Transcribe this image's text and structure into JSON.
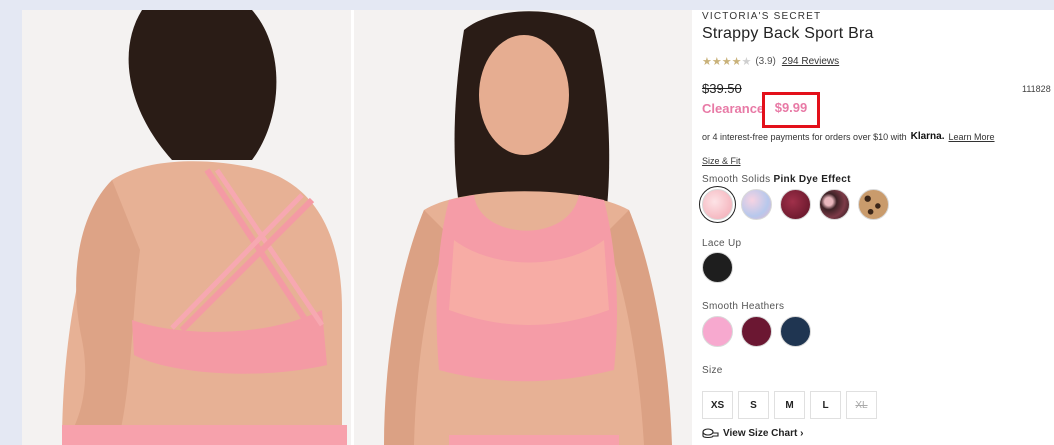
{
  "product": {
    "brand": "VICTORIA'S SECRET",
    "title": "Strappy Back Sport Bra",
    "rating_value": "(3.9)",
    "rating_stars": 3.9,
    "reviews_label": "294 Reviews",
    "original_price": "$39.50",
    "sku": "111828",
    "clearance_label": "Clearance",
    "sale_price": "$9.99",
    "installments_text": "or 4 interest-free payments for orders over $10 with",
    "klarna_label": "Klarna.",
    "learn_more": "Learn More",
    "size_fit": "Size & Fit"
  },
  "colors": {
    "smooth_solids_label": "Smooth Solids",
    "selected_color": "Pink Dye Effect",
    "smooth_solids": [
      {
        "name": "Pink Dye Effect",
        "color": "#f5c1c6"
      },
      {
        "name": "Blue Pink Dye",
        "color": "#c8d4ee"
      },
      {
        "name": "Wine Dye",
        "color": "#7a1d2e"
      },
      {
        "name": "Dark Floral",
        "color": "#4a2a30"
      },
      {
        "name": "Leopard",
        "color": "#b8865a"
      }
    ],
    "lace_up_label": "Lace Up",
    "lace_up": [
      {
        "name": "Black",
        "color": "#1e1e1e"
      }
    ],
    "smooth_heathers_label": "Smooth Heathers",
    "smooth_heathers": [
      {
        "name": "Pink Heather",
        "color": "#f7a9cf"
      },
      {
        "name": "Burgundy Heather",
        "color": "#6b1732"
      },
      {
        "name": "Navy Heather",
        "color": "#1f3551"
      }
    ]
  },
  "sizes": {
    "label": "Size",
    "options": [
      {
        "label": "XS",
        "available": true
      },
      {
        "label": "S",
        "available": true
      },
      {
        "label": "M",
        "available": true
      },
      {
        "label": "L",
        "available": true
      },
      {
        "label": "XL",
        "available": false
      }
    ]
  },
  "size_chart_label": "View Size Chart ›",
  "accent": {
    "sale_pink": "#e87aa6",
    "highlight_red": "#e3101a"
  }
}
